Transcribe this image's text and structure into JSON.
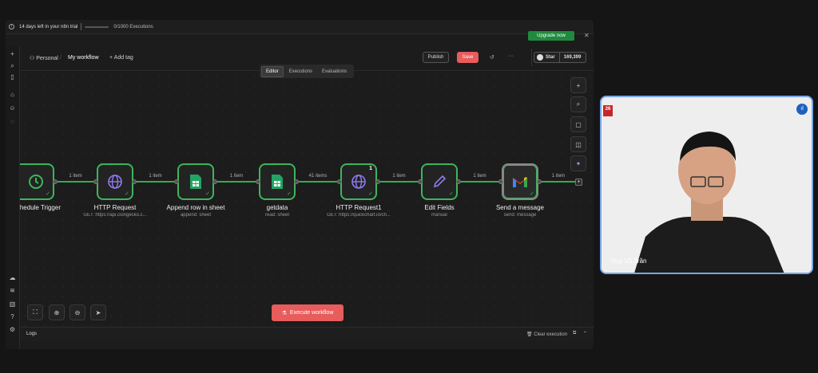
{
  "trial": {
    "text": "14 days left in your n8n trial",
    "executions": "0/1000 Executions",
    "progress_fraction": 0.0,
    "upgrade_label": "Upgrade now"
  },
  "header": {
    "project": "Personal",
    "workflow_name": "My workflow",
    "add_tag": "+ Add tag",
    "publish_label": "Publish",
    "save_label": "Save",
    "github_star": "Star",
    "github_count": "169,399"
  },
  "tabs": [
    {
      "label": "Editor",
      "active": true
    },
    {
      "label": "Executions",
      "active": false
    },
    {
      "label": "Evaluations",
      "active": false
    }
  ],
  "nodes": [
    {
      "title": "hedule Trigger",
      "subtitle": "",
      "icon": "clock-icon"
    },
    {
      "title": "HTTP Request",
      "subtitle": "GET: https://api.coingecko.c...",
      "icon": "globe-icon"
    },
    {
      "title": "Append row in sheet",
      "subtitle": "append: sheet",
      "icon": "sheets-icon"
    },
    {
      "title": "getdata",
      "subtitle": "read: sheet",
      "icon": "sheets-icon"
    },
    {
      "title": "HTTP Request1",
      "subtitle": "GET: https://quickchart.io/ch...",
      "icon": "globe-icon",
      "runs": "1"
    },
    {
      "title": "Edit Fields",
      "subtitle": "manual",
      "icon": "pencil-icon"
    },
    {
      "title": "Send a message",
      "subtitle": "send: message",
      "icon": "gmail-icon"
    }
  ],
  "connections": [
    {
      "label": "1 item"
    },
    {
      "label": "1 item"
    },
    {
      "label": "1 item"
    },
    {
      "label": "41 items"
    },
    {
      "label": "1 item"
    },
    {
      "label": "1 item"
    },
    {
      "label": "1 item"
    }
  ],
  "execute_label": "Execute workflow",
  "logs": {
    "title": "Logs",
    "clear_label": "Clear execution"
  },
  "video": {
    "name": "Huy Vũ Trần",
    "badge": "26"
  },
  "colors": {
    "accent_green": "#3db55c",
    "save_red": "#e85c5c",
    "upgrade_green": "#1f8a3e",
    "video_border": "#7aa6e8"
  }
}
